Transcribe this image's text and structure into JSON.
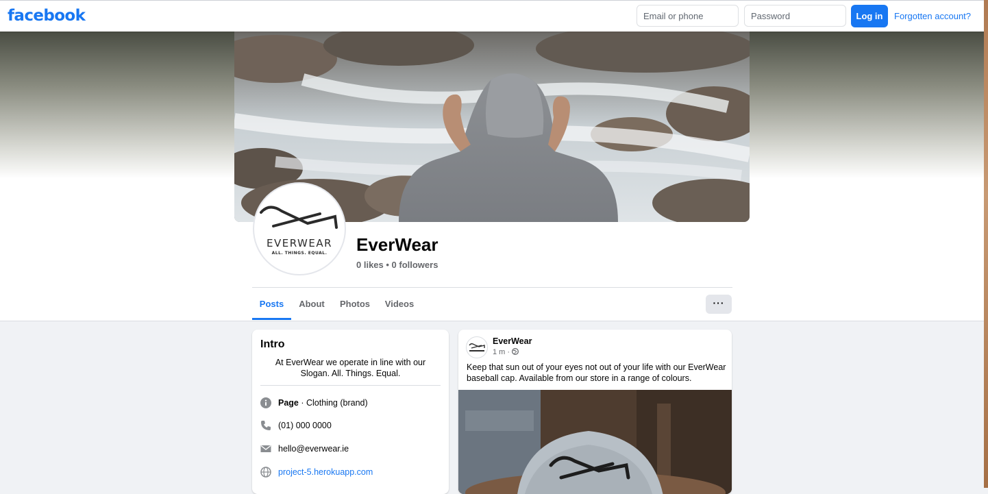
{
  "topbar": {
    "logo": "facebook",
    "email_placeholder": "Email or phone",
    "password_placeholder": "Password",
    "login_label": "Log in",
    "forgot_label": "Forgotten account?"
  },
  "profile": {
    "name": "EverWear",
    "stats": "0 likes • 0 followers",
    "logo_word": "EVERWEAR",
    "logo_tagline": "ALL. THINGS. EQUAL."
  },
  "tabs": [
    "Posts",
    "About",
    "Photos",
    "Videos"
  ],
  "more_label": "···",
  "intro": {
    "title": "Intro",
    "bio": "At EverWear we operate in line with our Slogan. All. Things. Equal.",
    "category_label": "Page",
    "category_value": " · Clothing (brand)",
    "phone": "(01) 000 0000",
    "email": "hello@everwear.ie",
    "website": "project-5.herokuapp.com"
  },
  "post": {
    "author": "EverWear",
    "time": "1 m · ",
    "text": "Keep that sun out of your eyes not out of your life with our EverWear baseball cap. Available from our store in a range of colours."
  },
  "colors": {
    "brand_blue": "#1877f2",
    "page_bg": "#f0f2f5",
    "secondary_text": "#65676b"
  },
  "icons": [
    "info-icon",
    "phone-icon",
    "mail-icon",
    "globe-icon",
    "globe-privacy-icon",
    "more-icon"
  ]
}
